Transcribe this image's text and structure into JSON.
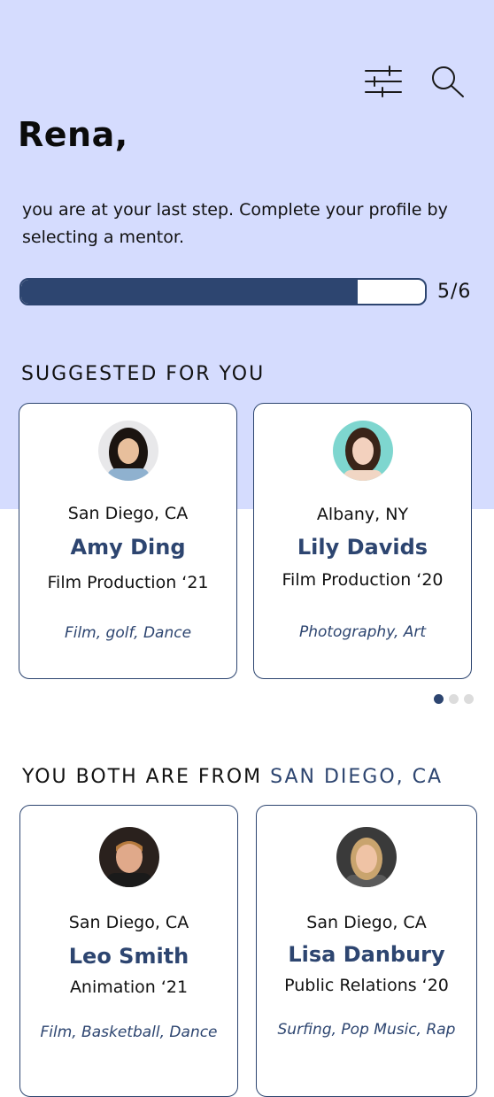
{
  "header": {
    "greeting": "Rena,",
    "intro": "you are at your last step. Complete your profile by selecting a mentor.",
    "progress": {
      "text": "5/6",
      "fraction": 0.8333
    }
  },
  "icons": {
    "filter": "sliders-icon",
    "search": "search-icon"
  },
  "colors": {
    "top_background": "#d5dcfe",
    "accent": "#2d4570"
  },
  "suggested": {
    "title": "SUGGESTED FOR YOU",
    "cards": [
      {
        "location": "San Diego, CA",
        "name": "Amy Ding",
        "major": "Film Production ‘21",
        "interests": "Film, golf, Dance"
      },
      {
        "location": "Albany, NY",
        "name": "Lily Davids",
        "major": "Film Production ‘20",
        "interests": "Photography, Art"
      }
    ],
    "pager": {
      "count": 3,
      "active": 1
    }
  },
  "same_location": {
    "title_prefix": "YOU BOTH ARE FROM ",
    "title_highlight": "SAN DIEGO, CA",
    "cards": [
      {
        "location": "San Diego, CA",
        "name": "Leo Smith",
        "major": "Animation ‘21",
        "interests": "Film, Basketball, Dance"
      },
      {
        "location": "San Diego, CA",
        "name": "Lisa Danbury",
        "major": "Public Relations ‘20",
        "interests": "Surfing, Pop Music, Rap"
      }
    ]
  }
}
